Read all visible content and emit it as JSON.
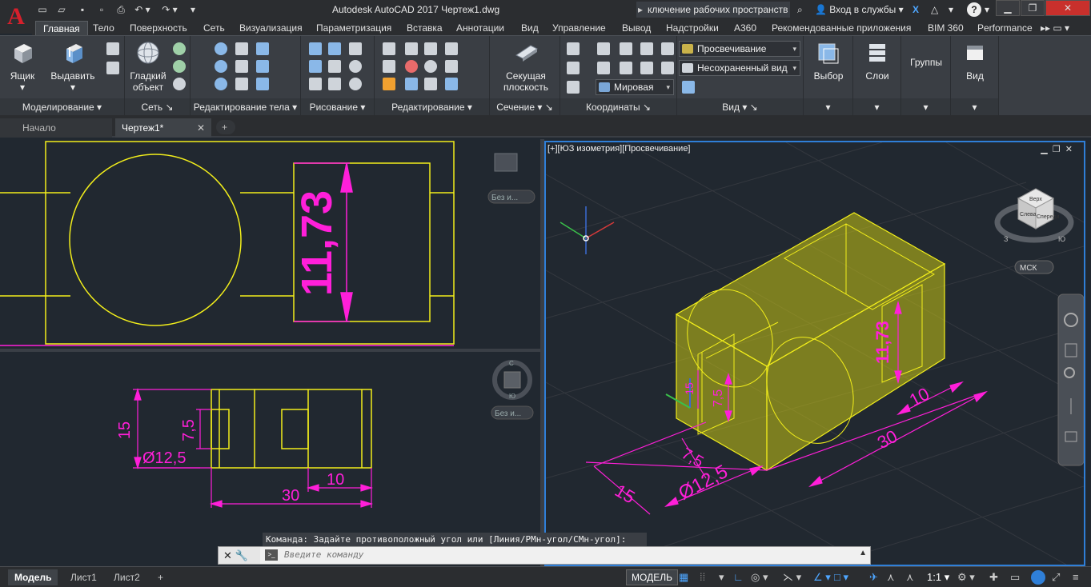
{
  "app": {
    "logo": "A",
    "title": "Autodesk AutoCAD 2017    Чертеж1.dwg",
    "workspace_switch": "ключение рабочих пространств",
    "signin": "Вход в службы",
    "help": "?"
  },
  "ribbon_tabs": [
    "Главная",
    "Тело",
    "Поверхность",
    "Сеть",
    "Визуализация",
    "Параметризация",
    "Вставка",
    "Аннотации",
    "Вид",
    "Управление",
    "Вывод",
    "Надстройки",
    "A360",
    "Рекомендованные приложения",
    "BIM 360",
    "Performance"
  ],
  "panels": {
    "modeling": {
      "title": "Моделирование",
      "box": "Ящик",
      "extrude": "Выдавить"
    },
    "mesh": {
      "title": "Сеть",
      "smooth": "Гладкий объект"
    },
    "solid_edit": {
      "title": "Редактирование тела"
    },
    "draw": {
      "title": "Рисование"
    },
    "modify": {
      "title": "Редактирование"
    },
    "section": {
      "title": "Сечение",
      "plane": "Секущая плоскость"
    },
    "coords": {
      "title": "Координаты",
      "ucs_world": "Мировая"
    },
    "view": {
      "title": "Вид",
      "visual_style": "Просвечивание",
      "named_view": "Несохраненный вид"
    },
    "selection": "Выбор",
    "layers": "Слои",
    "groups": "Группы",
    "view_panel": "Вид"
  },
  "doc_tabs": {
    "start": "Начало",
    "drawing": "Чертеж1*",
    "add": "+"
  },
  "viewports": {
    "iso_label": "[+][ЮЗ изометрия][Просвечивание]",
    "wcs": "МСК",
    "base1": "Без и...",
    "base2": "Без и...",
    "viewcube_face_top": "Верх",
    "viewcube_face_left": "Слева",
    "viewcube_face_front": "Спереди",
    "compass_w": "З",
    "compass_s": "Ю",
    "compass_n": "С"
  },
  "dimensions": {
    "top_height": "11,73",
    "front_height": "15",
    "front_inner": "7,5",
    "front_diameter": "Ø12,5",
    "front_length": "30",
    "front_step": "10",
    "iso_height": "11,73",
    "iso_inner": "7,5",
    "iso_small": "15",
    "iso_length": "30",
    "iso_step": "10",
    "iso_diameter": "Ø12,5",
    "iso_front": "15",
    "iso_front_inner": "7,5"
  },
  "command": {
    "history": "Команда: Задайте противоположный угол или [Линия/РМн-угол/СМн-угол]:",
    "placeholder": "Введите команду",
    "close": "✕",
    "wrench": "🔧",
    "prompt": ">_"
  },
  "layout_tabs": [
    "Модель",
    "Лист1",
    "Лист2"
  ],
  "layout_add": "+",
  "status": {
    "model": "МОДЕЛЬ",
    "scale": "1:1"
  },
  "colors": {
    "yellow": "#f2ee1b",
    "magenta": "#ff1fd9",
    "accent": "#2f7fd8",
    "bg": "#212830"
  }
}
